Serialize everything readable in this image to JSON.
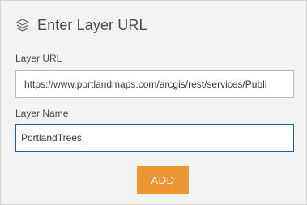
{
  "dialog": {
    "title": "Enter Layer URL",
    "title_icon": "layers-icon"
  },
  "layer_url": {
    "label": "Layer URL",
    "value": "https://www.portlandmaps.com/arcgis/rest/services/Publi"
  },
  "layer_name": {
    "label": "Layer Name",
    "value": "PortlandTrees"
  },
  "add_button": {
    "label": "ADD",
    "color": "#ec9631"
  }
}
